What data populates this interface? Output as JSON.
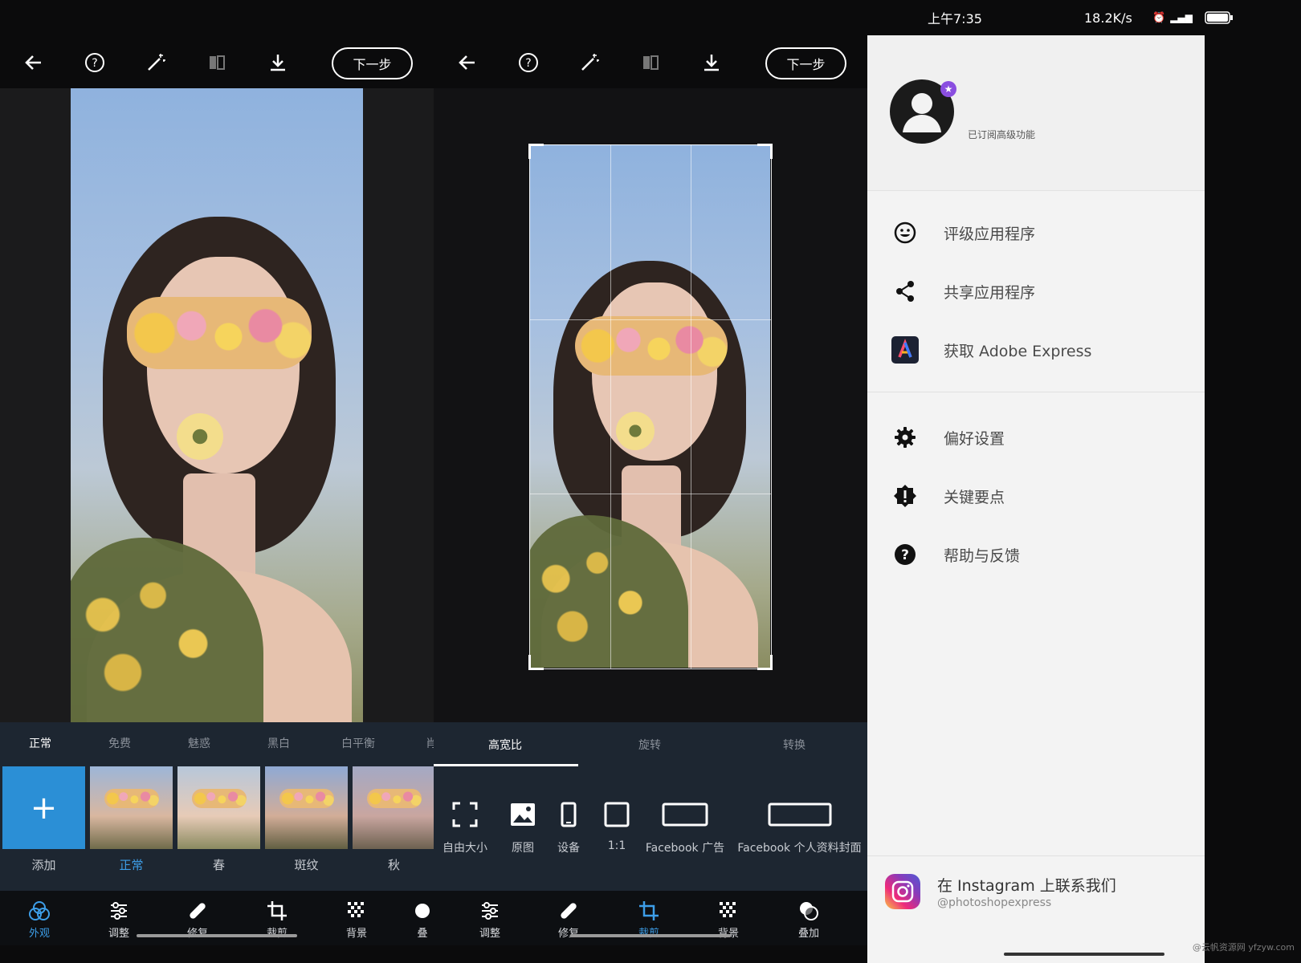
{
  "editor": {
    "next_label": "下一步",
    "filter_tabs": [
      "正常",
      "免费",
      "魅惑",
      "黑白",
      "白平衡",
      "肖"
    ],
    "filters": [
      {
        "label": "添加"
      },
      {
        "label": "正常"
      },
      {
        "label": "春"
      },
      {
        "label": "斑纹"
      },
      {
        "label": "秋"
      }
    ],
    "nav": [
      {
        "label": "外观",
        "icon": "looks-icon"
      },
      {
        "label": "调整",
        "icon": "adjust-icon"
      },
      {
        "label": "修复",
        "icon": "heal-icon"
      },
      {
        "label": "裁剪",
        "icon": "crop-icon"
      },
      {
        "label": "背景",
        "icon": "background-icon"
      },
      {
        "label": "叠",
        "icon": "blend-icon"
      }
    ]
  },
  "crop": {
    "next_label": "下一步",
    "tabs": [
      "高宽比",
      "旋转",
      "转换"
    ],
    "options": [
      {
        "label": "自由大小",
        "icon": "free-size-icon"
      },
      {
        "label": "原图",
        "icon": "original-icon"
      },
      {
        "label": "设备",
        "icon": "device-icon"
      },
      {
        "label": "1:1",
        "icon": "square-icon"
      },
      {
        "label": "Facebook 广告",
        "icon": "fb-ad-icon"
      },
      {
        "label": "Facebook 个人资料封面",
        "icon": "fb-cover-icon"
      }
    ],
    "nav": [
      {
        "label": "调整",
        "icon": "adjust-icon"
      },
      {
        "label": "修复",
        "icon": "heal-icon"
      },
      {
        "label": "裁剪",
        "icon": "crop-icon"
      },
      {
        "label": "背景",
        "icon": "background-icon"
      },
      {
        "label": "叠加",
        "icon": "blend-icon"
      }
    ]
  },
  "drawer": {
    "status_time": "上午7:35",
    "status_right": "18.2K/s",
    "battery": "97",
    "subscription": "已订阅高级功能",
    "menu": [
      {
        "label": "评级应用程序",
        "icon": "smile-icon"
      },
      {
        "label": "共享应用程序",
        "icon": "share-icon"
      },
      {
        "label": "获取 Adobe Express",
        "icon": "adobe-express-icon"
      },
      {
        "label": "偏好设置",
        "icon": "gear-icon"
      },
      {
        "label": "关键要点",
        "icon": "alert-badge-icon"
      },
      {
        "label": "帮助与反馈",
        "icon": "help-icon"
      }
    ],
    "instagram_title": "在 Instagram 上联系我们",
    "instagram_handle": "@photoshopexpress"
  },
  "watermark": "@云帆资源网 yfzyw.com",
  "colors": {
    "accent": "#3d9ee8",
    "panel_bg": "#1d2631",
    "drawer_bg": "#f3f3f3"
  }
}
